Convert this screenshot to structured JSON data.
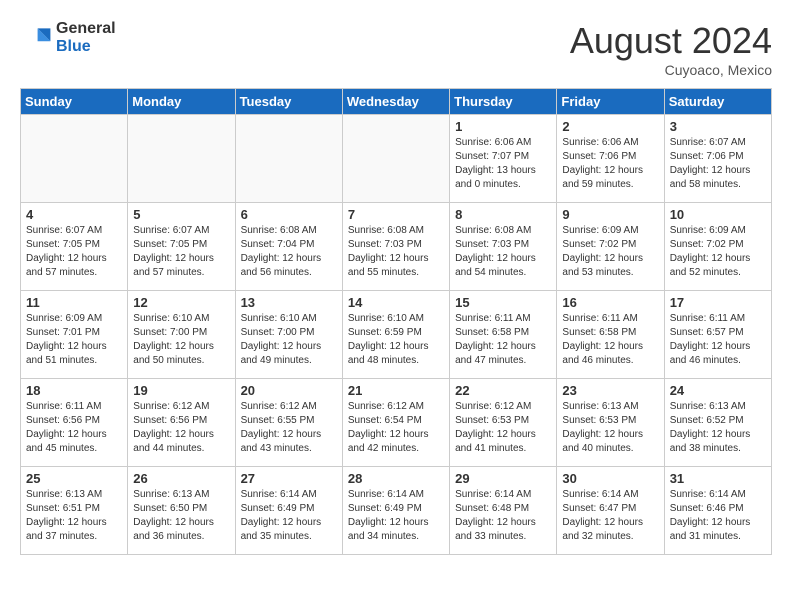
{
  "logo": {
    "general": "General",
    "blue": "Blue"
  },
  "title": "August 2024",
  "location": "Cuyoaco, Mexico",
  "days_of_week": [
    "Sunday",
    "Monday",
    "Tuesday",
    "Wednesday",
    "Thursday",
    "Friday",
    "Saturday"
  ],
  "weeks": [
    [
      {
        "day": "",
        "info": ""
      },
      {
        "day": "",
        "info": ""
      },
      {
        "day": "",
        "info": ""
      },
      {
        "day": "",
        "info": ""
      },
      {
        "day": "1",
        "info": "Sunrise: 6:06 AM\nSunset: 7:07 PM\nDaylight: 13 hours\nand 0 minutes."
      },
      {
        "day": "2",
        "info": "Sunrise: 6:06 AM\nSunset: 7:06 PM\nDaylight: 12 hours\nand 59 minutes."
      },
      {
        "day": "3",
        "info": "Sunrise: 6:07 AM\nSunset: 7:06 PM\nDaylight: 12 hours\nand 58 minutes."
      }
    ],
    [
      {
        "day": "4",
        "info": "Sunrise: 6:07 AM\nSunset: 7:05 PM\nDaylight: 12 hours\nand 57 minutes."
      },
      {
        "day": "5",
        "info": "Sunrise: 6:07 AM\nSunset: 7:05 PM\nDaylight: 12 hours\nand 57 minutes."
      },
      {
        "day": "6",
        "info": "Sunrise: 6:08 AM\nSunset: 7:04 PM\nDaylight: 12 hours\nand 56 minutes."
      },
      {
        "day": "7",
        "info": "Sunrise: 6:08 AM\nSunset: 7:03 PM\nDaylight: 12 hours\nand 55 minutes."
      },
      {
        "day": "8",
        "info": "Sunrise: 6:08 AM\nSunset: 7:03 PM\nDaylight: 12 hours\nand 54 minutes."
      },
      {
        "day": "9",
        "info": "Sunrise: 6:09 AM\nSunset: 7:02 PM\nDaylight: 12 hours\nand 53 minutes."
      },
      {
        "day": "10",
        "info": "Sunrise: 6:09 AM\nSunset: 7:02 PM\nDaylight: 12 hours\nand 52 minutes."
      }
    ],
    [
      {
        "day": "11",
        "info": "Sunrise: 6:09 AM\nSunset: 7:01 PM\nDaylight: 12 hours\nand 51 minutes."
      },
      {
        "day": "12",
        "info": "Sunrise: 6:10 AM\nSunset: 7:00 PM\nDaylight: 12 hours\nand 50 minutes."
      },
      {
        "day": "13",
        "info": "Sunrise: 6:10 AM\nSunset: 7:00 PM\nDaylight: 12 hours\nand 49 minutes."
      },
      {
        "day": "14",
        "info": "Sunrise: 6:10 AM\nSunset: 6:59 PM\nDaylight: 12 hours\nand 48 minutes."
      },
      {
        "day": "15",
        "info": "Sunrise: 6:11 AM\nSunset: 6:58 PM\nDaylight: 12 hours\nand 47 minutes."
      },
      {
        "day": "16",
        "info": "Sunrise: 6:11 AM\nSunset: 6:58 PM\nDaylight: 12 hours\nand 46 minutes."
      },
      {
        "day": "17",
        "info": "Sunrise: 6:11 AM\nSunset: 6:57 PM\nDaylight: 12 hours\nand 46 minutes."
      }
    ],
    [
      {
        "day": "18",
        "info": "Sunrise: 6:11 AM\nSunset: 6:56 PM\nDaylight: 12 hours\nand 45 minutes."
      },
      {
        "day": "19",
        "info": "Sunrise: 6:12 AM\nSunset: 6:56 PM\nDaylight: 12 hours\nand 44 minutes."
      },
      {
        "day": "20",
        "info": "Sunrise: 6:12 AM\nSunset: 6:55 PM\nDaylight: 12 hours\nand 43 minutes."
      },
      {
        "day": "21",
        "info": "Sunrise: 6:12 AM\nSunset: 6:54 PM\nDaylight: 12 hours\nand 42 minutes."
      },
      {
        "day": "22",
        "info": "Sunrise: 6:12 AM\nSunset: 6:53 PM\nDaylight: 12 hours\nand 41 minutes."
      },
      {
        "day": "23",
        "info": "Sunrise: 6:13 AM\nSunset: 6:53 PM\nDaylight: 12 hours\nand 40 minutes."
      },
      {
        "day": "24",
        "info": "Sunrise: 6:13 AM\nSunset: 6:52 PM\nDaylight: 12 hours\nand 38 minutes."
      }
    ],
    [
      {
        "day": "25",
        "info": "Sunrise: 6:13 AM\nSunset: 6:51 PM\nDaylight: 12 hours\nand 37 minutes."
      },
      {
        "day": "26",
        "info": "Sunrise: 6:13 AM\nSunset: 6:50 PM\nDaylight: 12 hours\nand 36 minutes."
      },
      {
        "day": "27",
        "info": "Sunrise: 6:14 AM\nSunset: 6:49 PM\nDaylight: 12 hours\nand 35 minutes."
      },
      {
        "day": "28",
        "info": "Sunrise: 6:14 AM\nSunset: 6:49 PM\nDaylight: 12 hours\nand 34 minutes."
      },
      {
        "day": "29",
        "info": "Sunrise: 6:14 AM\nSunset: 6:48 PM\nDaylight: 12 hours\nand 33 minutes."
      },
      {
        "day": "30",
        "info": "Sunrise: 6:14 AM\nSunset: 6:47 PM\nDaylight: 12 hours\nand 32 minutes."
      },
      {
        "day": "31",
        "info": "Sunrise: 6:14 AM\nSunset: 6:46 PM\nDaylight: 12 hours\nand 31 minutes."
      }
    ]
  ]
}
